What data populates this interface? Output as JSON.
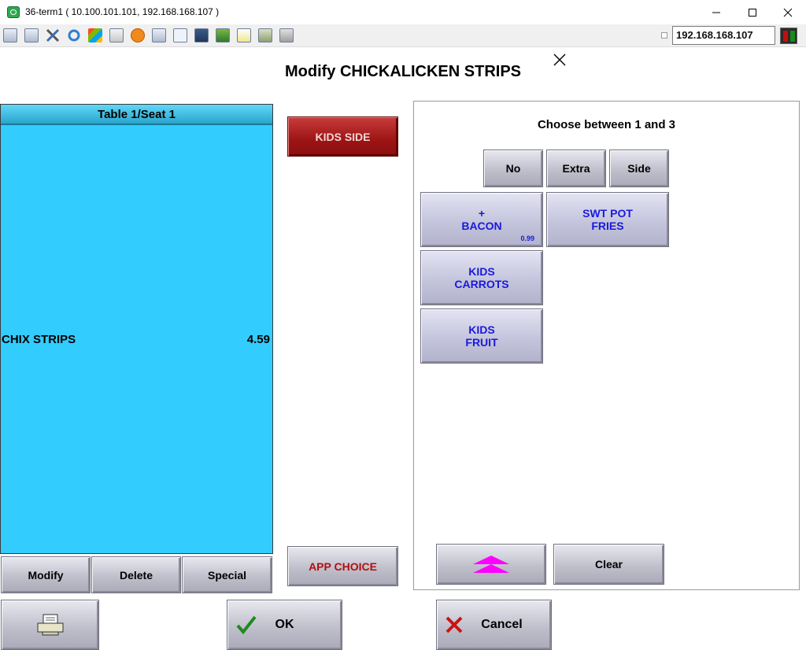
{
  "window": {
    "title": "36-term1 ( 10.100.101.101, 192.168.168.107 )"
  },
  "toolbar": {
    "icons": [
      "monitor-icon",
      "windows-icon",
      "tools-icon",
      "refresh-icon",
      "flag-icon",
      "keyboard-icon",
      "alert-icon",
      "network-icon",
      "fullscreen-icon",
      "display-icon",
      "download-icon",
      "document-icon",
      "map-icon",
      "chat-icon"
    ],
    "ip_address": "192.168.168.107"
  },
  "dialog": {
    "title": "Modify CHICKALICKEN STRIPS"
  },
  "order": {
    "header": "Table 1/Seat 1",
    "items": [
      {
        "name": "CHIX STRIPS",
        "price": "4.59"
      }
    ],
    "buttons": {
      "modify": "Modify",
      "delete": "Delete",
      "special": "Special"
    }
  },
  "groups": {
    "kids_side": "KIDS SIDE",
    "app_choice": "APP CHOICE"
  },
  "modifiers": {
    "instruction": "Choose between 1 and 3",
    "options": {
      "no": "No",
      "extra": "Extra",
      "side": "Side"
    },
    "items": [
      {
        "line1": "+",
        "line2": "BACON",
        "price": "0.99"
      },
      {
        "line1": "SWT POT",
        "line2": "FRIES"
      },
      {
        "line1": "KIDS",
        "line2": "CARROTS"
      },
      {
        "line1": "KIDS",
        "line2": "FRUIT"
      }
    ],
    "clear": "Clear"
  },
  "footer": {
    "ok": "OK",
    "cancel": "Cancel"
  },
  "colors": {
    "order_panel": "#33ccff",
    "kids_side_button": "#9c1414",
    "modifier_text": "#1a1adb",
    "scroll_arrow": "#ff00ff"
  }
}
